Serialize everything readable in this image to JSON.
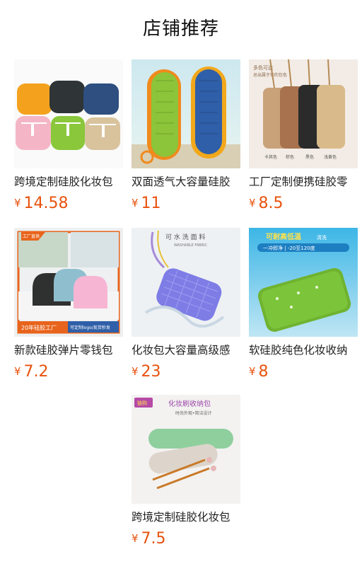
{
  "header": {
    "title": "店铺推荐"
  },
  "products": [
    {
      "name": "跨境定制硅胶化妆包",
      "currency": "¥",
      "price": "14.58"
    },
    {
      "name": "双面透气大容量硅胶",
      "currency": "¥",
      "price": "11"
    },
    {
      "name": "工厂定制便携硅胶零",
      "currency": "¥",
      "price": "8.5"
    },
    {
      "name": "新款硅胶弹片零钱包",
      "currency": "¥",
      "price": "7.2"
    },
    {
      "name": "化妆包大容量高级感",
      "currency": "¥",
      "price": "23"
    },
    {
      "name": "软硅胶纯色化妆收纳",
      "currency": "¥",
      "price": "8"
    },
    {
      "name": "跨境定制硅胶化妆包",
      "currency": "¥",
      "price": "7.5"
    }
  ],
  "image_text": {
    "p3_top": "多色可选",
    "p3_sub": "总出属于你的包色",
    "p3_colors": [
      "卡其色",
      "棕色",
      "黑色",
      "浅黄色"
    ],
    "p4_badge": "工厂直供",
    "p4_banner_left": "20年硅胶工厂",
    "p4_banner_right": "可定制logo/现货秒发",
    "p5_title": "可 水 洗 面 料",
    "p5_sub": "WASHABLE FABRIC",
    "p6_title": "可耐高低温",
    "p6_title2": "清洗",
    "p6_sub": "一冲即净 | -20至120度",
    "p7_badge": "链购",
    "p7_title": "化妆刷收纳包",
    "p7_sub": "时尚外观•简洁设计"
  },
  "colors": {
    "price": "#e8520e",
    "title": "#111111"
  }
}
